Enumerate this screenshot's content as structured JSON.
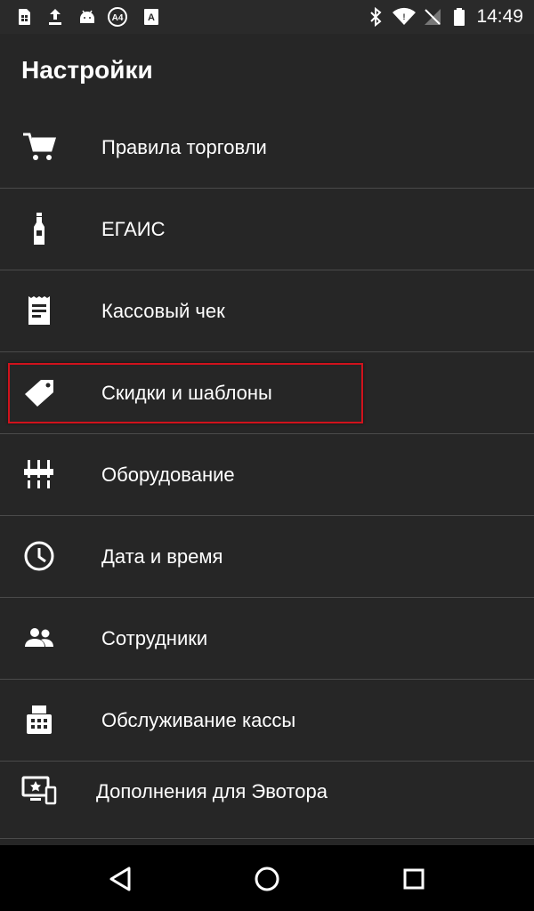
{
  "status_bar": {
    "time": "14:49",
    "left_icons": [
      "sim-icon",
      "upload-icon",
      "android-icon",
      "a4-icon",
      "accessibility-icon"
    ],
    "right_icons": [
      "bluetooth-icon",
      "wifi-icon",
      "no-signal-icon",
      "battery-icon"
    ]
  },
  "app_bar": {
    "title": "Настройки"
  },
  "settings": {
    "items": [
      {
        "label": "Правила торговли",
        "icon": "cart-icon"
      },
      {
        "label": "ЕГАИС",
        "icon": "bottle-icon"
      },
      {
        "label": "Кассовый чек",
        "icon": "receipt-icon"
      },
      {
        "label": "Скидки и шаблоны",
        "icon": "tag-icon"
      },
      {
        "label": "Оборудование",
        "icon": "equalizer-icon"
      },
      {
        "label": "Дата и время",
        "icon": "clock-icon"
      },
      {
        "label": "Сотрудники",
        "icon": "people-icon"
      },
      {
        "label": "Обслуживание кассы",
        "icon": "fax-icon"
      },
      {
        "label": "Дополнения для Эвотора",
        "icon": "devices-star-icon"
      }
    ],
    "highlighted_item": "Скидки и шаблоны",
    "highlight_color": "#d0121c"
  },
  "nav_bar": {
    "buttons": [
      "back-icon",
      "home-icon",
      "recents-icon"
    ]
  }
}
